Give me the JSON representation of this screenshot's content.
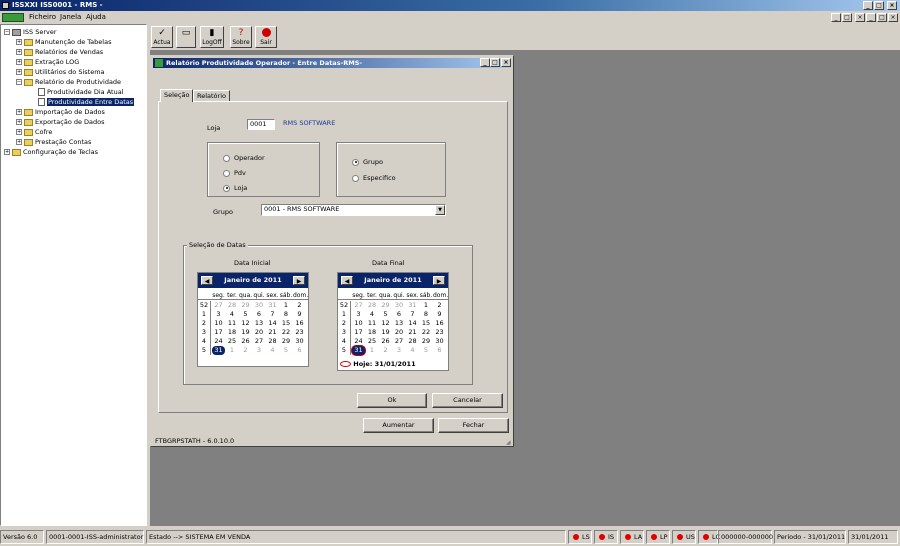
{
  "app": {
    "title": "ISSXXI ISS0001 - RMS -"
  },
  "menu": {
    "items": [
      "Ficheiro",
      "Janela",
      "Ajuda"
    ]
  },
  "toolbar": {
    "buttons": [
      {
        "label": "Actua",
        "icon": "checkmark-icon"
      },
      {
        "label": "",
        "icon": "window-icon"
      },
      {
        "label": "LogOff",
        "icon": "logoff-icon"
      },
      {
        "label": "Sobre",
        "icon": "help-icon"
      },
      {
        "label": "Sair",
        "icon": "stop-icon"
      }
    ]
  },
  "tree": {
    "root": "ISS Server",
    "items": [
      "Manutenção de Tabelas",
      "Relatórios de Vendas",
      "Extração LOG",
      "Utilitários do Sistema",
      "Relatório de Produtividade",
      "Produtividade Dia Atual",
      "Produtividade Entre Datas",
      "Importação de Dados",
      "Exportação de Dados",
      "Cofre",
      "Prestação Contas",
      "Configuração de Teclas"
    ]
  },
  "dialog": {
    "title": "Relatório Produtividade Operador - Entre Datas-RMS-",
    "tabs": [
      "Seleção",
      "Relatório"
    ],
    "loja_label": "Loja",
    "loja_code": "0001",
    "loja_name": "RMS SOFTWARE",
    "options_left": [
      "Operador",
      "Pdv",
      "Loja"
    ],
    "options_right": [
      "Grupo",
      "Especifico"
    ],
    "grupo_label": "Grupo",
    "grupo_value": "0001 - RMS SOFTWARE",
    "dates_group": "Seleção de Datas",
    "data_inicial_label": "Data Inicial",
    "data_final_label": "Data Final",
    "ok_label": "Ok",
    "cancel_label": "Cancelar",
    "aumentar_label": "Aumentar",
    "fechar_label": "Fechar",
    "version": "FTBGRPSTATH - 6.0.10.0"
  },
  "calendar": {
    "month": "Janeiro de 2011",
    "weekdays": [
      "seg.",
      "ter.",
      "qua.",
      "qui.",
      "sex.",
      "sáb.",
      "dom."
    ],
    "weeks": [
      "52",
      "1",
      "2",
      "3",
      "4",
      "5"
    ],
    "days": [
      [
        "27",
        "28",
        "29",
        "30",
        "31",
        "1",
        "2"
      ],
      [
        "3",
        "4",
        "5",
        "6",
        "7",
        "8",
        "9"
      ],
      [
        "10",
        "11",
        "12",
        "13",
        "14",
        "15",
        "16"
      ],
      [
        "17",
        "18",
        "19",
        "20",
        "21",
        "22",
        "23"
      ],
      [
        "24",
        "25",
        "26",
        "27",
        "28",
        "29",
        "30"
      ],
      [
        "31",
        "1",
        "2",
        "3",
        "4",
        "5",
        "6"
      ]
    ],
    "today_label": "Hoje: 31/01/2011"
  },
  "status": {
    "version": "Versão 6.0",
    "user": "0001-0001-ISS-administrator",
    "state": "Estado --> SISTEMA EM VENDA",
    "indicators": [
      "LS",
      "IS",
      "LA",
      "LP",
      "US",
      "LC"
    ],
    "code": "000000-000000",
    "period": "Período - 31/01/2011",
    "date": "31/01/2011"
  },
  "colors": {
    "titlebar": "#0a246a",
    "desktop": "#808080",
    "indicator": "#e00000",
    "link": "#1a3a9a"
  }
}
